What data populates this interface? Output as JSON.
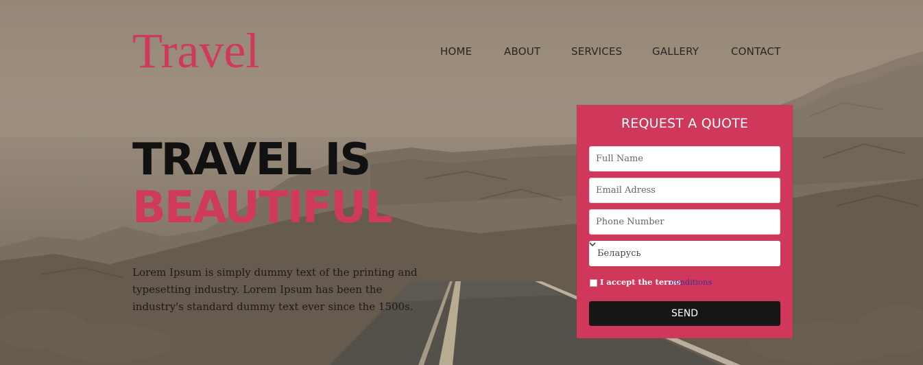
{
  "brand": {
    "logo_text": "Travel",
    "accent_color": "#cf3a5c"
  },
  "nav": {
    "items": [
      {
        "label": "HOME"
      },
      {
        "label": "ABOUT"
      },
      {
        "label": "SERVICES"
      },
      {
        "label": "GALLERY"
      },
      {
        "label": "CONTACT"
      }
    ]
  },
  "hero": {
    "headline_line1": "TRAVEL IS",
    "headline_line2": "BEAUTIFUL",
    "lead": "Lorem Ipsum is simply dummy text of the printing and typesetting industry. Lorem Ipsum has been the industry's standard dummy text ever since the 1500s."
  },
  "quote_form": {
    "title": "REQUEST A QUOTE",
    "full_name_placeholder": "Full Name",
    "email_placeholder": "Email Adress",
    "phone_placeholder": "Phone Number",
    "country_selected": "Беларусь",
    "terms_label": "I accept the terms",
    "terms_link": "conditions",
    "send_label": "SEND",
    "panel_color": "#d0385b",
    "button_color": "#161616"
  }
}
